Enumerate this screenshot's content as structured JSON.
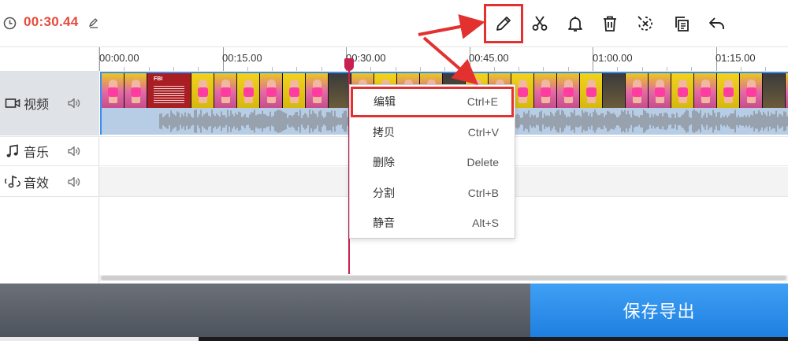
{
  "topbar": {
    "time": "00:30.44",
    "tools": [
      {
        "name": "edit",
        "icon": "pencil-icon"
      },
      {
        "name": "split",
        "icon": "scissors-icon"
      },
      {
        "name": "notify",
        "icon": "bell-icon"
      },
      {
        "name": "delete",
        "icon": "trash-icon"
      },
      {
        "name": "detach",
        "icon": "broken-link-icon"
      },
      {
        "name": "copy",
        "icon": "copy-icon"
      },
      {
        "name": "undo",
        "icon": "undo-icon"
      }
    ]
  },
  "tracks": [
    {
      "label": "视频",
      "icon": "video-camera-icon"
    },
    {
      "label": "音乐",
      "icon": "music-note-icon"
    },
    {
      "label": "音效",
      "icon": "sound-effect-icon"
    }
  ],
  "ruler": {
    "ticks": [
      "00:00.00",
      "00:15.00",
      "00:30.00",
      "00:45.00",
      "01:00.00",
      "01:15.00"
    ]
  },
  "playhead": {
    "time": "00:30.44"
  },
  "context_menu": {
    "items": [
      {
        "label": "编辑",
        "shortcut": "Ctrl+E"
      },
      {
        "label": "拷贝",
        "shortcut": "Ctrl+V"
      },
      {
        "label": "删除",
        "shortcut": "Delete"
      },
      {
        "label": "分割",
        "shortcut": "Ctrl+B"
      },
      {
        "label": "静音",
        "shortcut": "Alt+S"
      }
    ]
  },
  "bottom": {
    "export_label": "保存导出"
  },
  "colors": {
    "time_text": "#e64b3c",
    "highlight": "#e3312f",
    "playhead": "#c8204f",
    "clip_border": "#3c8df0",
    "export_button": "#2f8ff0"
  }
}
